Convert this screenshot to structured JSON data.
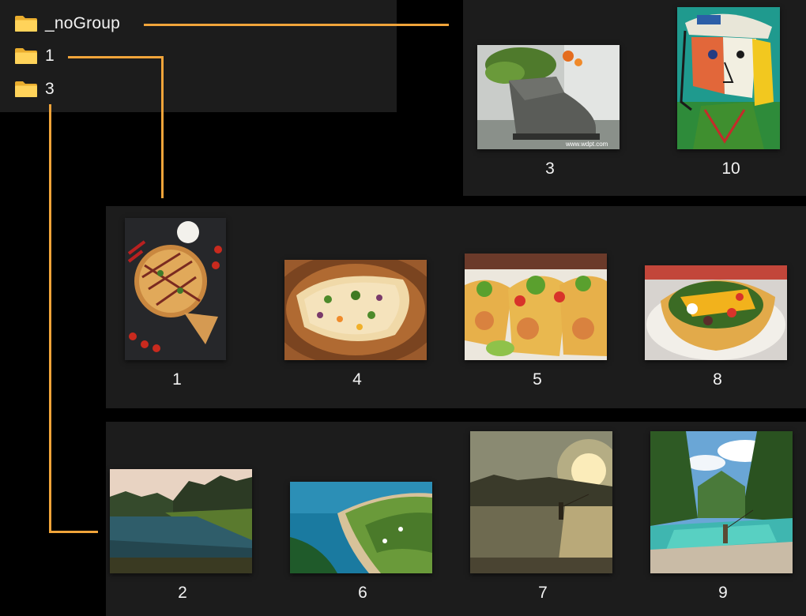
{
  "folders": [
    {
      "label": "_noGroup",
      "icon": "folder-icon"
    },
    {
      "label": "1",
      "icon": "folder-icon"
    },
    {
      "label": "3",
      "icon": "folder-icon"
    }
  ],
  "groups": {
    "nogroup": {
      "items": [
        {
          "label": "3",
          "image": "boot-planter-photo"
        },
        {
          "label": "10",
          "image": "cubist-portrait-painting"
        }
      ]
    },
    "g1": {
      "items": [
        {
          "label": "1",
          "image": "pizza-photo"
        },
        {
          "label": "4",
          "image": "flatbread-photo"
        },
        {
          "label": "5",
          "image": "tacos-photo"
        },
        {
          "label": "8",
          "image": "taco-salad-photo"
        }
      ]
    },
    "g3": {
      "items": [
        {
          "label": "2",
          "image": "river-landscape-photo"
        },
        {
          "label": "6",
          "image": "coastline-aerial-photo"
        },
        {
          "label": "7",
          "image": "sunset-fishing-photo"
        },
        {
          "label": "9",
          "image": "mountain-river-fishing-photo"
        }
      ]
    }
  },
  "colors": {
    "connector": "#f0a43a",
    "panel": "#1c1c1c",
    "background": "#000000",
    "folder": "#f6c644"
  }
}
